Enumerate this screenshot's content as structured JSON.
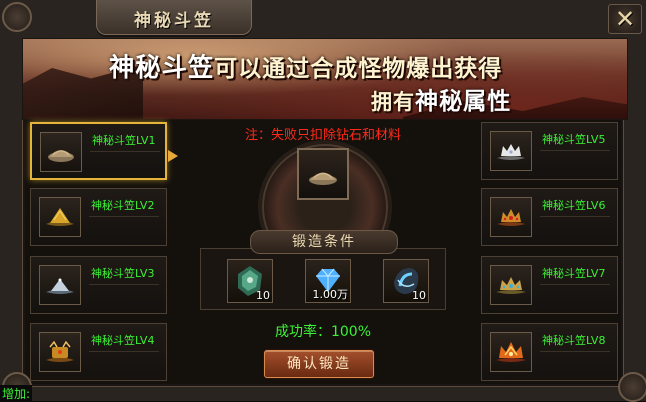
{
  "window": {
    "title": "神秘斗笠",
    "close_label": "✕"
  },
  "banner": {
    "line1_hl": "神秘斗笠",
    "line1_rest": "可以通过合成怪物爆出获得",
    "line2_pre": "拥有",
    "line2_hl": "神秘属性"
  },
  "left_items": [
    {
      "label": "神秘斗笠LV1",
      "icon": "sand-pile-icon",
      "selected": true
    },
    {
      "label": "神秘斗笠LV2",
      "icon": "golden-straw-hat-icon"
    },
    {
      "label": "神秘斗笠LV3",
      "icon": "silver-straw-hat-icon"
    },
    {
      "label": "神秘斗笠LV4",
      "icon": "ornate-gold-hat-icon"
    }
  ],
  "right_items": [
    {
      "label": "神秘斗笠LV5",
      "icon": "white-crown-hat-icon"
    },
    {
      "label": "神秘斗笠LV6",
      "icon": "red-gold-crown-icon"
    },
    {
      "label": "神秘斗笠LV7",
      "icon": "blue-gold-crown-icon"
    },
    {
      "label": "神秘斗笠LV8",
      "icon": "flame-crown-icon"
    }
  ],
  "center": {
    "note": "注：失败只扣除钻石和材料",
    "conditions_title": "锻造条件",
    "materials": [
      {
        "icon": "jade-stone-icon",
        "count": "10"
      },
      {
        "icon": "diamond-icon",
        "count": "1.00万"
      },
      {
        "icon": "blue-ore-icon",
        "count": "10"
      }
    ],
    "success_label": "成功率：",
    "success_value": "100%",
    "forge_button": "确认锻造"
  },
  "footer_text": "增加:",
  "colors": {
    "green": "#3bf035",
    "red_note": "#ff2a1a",
    "gold_select": "#e7b43a"
  }
}
